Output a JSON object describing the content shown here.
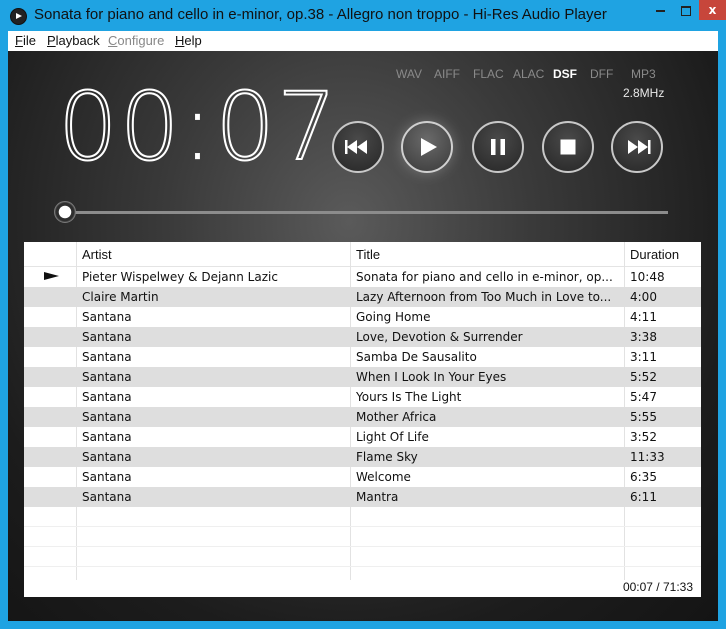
{
  "window": {
    "title": "Sonata for piano and cello in e-minor, op.38 - Allegro non troppo - Hi-Res Audio Player",
    "minimize": "minimize",
    "maximize": "maximize",
    "close": "x"
  },
  "menu": [
    {
      "label": "File",
      "underline": "F",
      "rest": "ile",
      "enabled": true
    },
    {
      "label": "Playback",
      "underline": "P",
      "rest": "layback",
      "enabled": true
    },
    {
      "label": "Configure",
      "underline": "C",
      "rest": "onfigure",
      "enabled": false
    },
    {
      "label": "Help",
      "underline": "H",
      "rest": "elp",
      "enabled": true
    }
  ],
  "formats": [
    "WAV",
    "AIFF",
    "FLAC",
    "ALAC",
    "DSF",
    "DFF",
    "MP3"
  ],
  "active_format": "DSF",
  "sample_rate": "2.8MHz",
  "time": {
    "minutes": "00",
    "seconds": "07"
  },
  "controls": [
    {
      "name": "previous-button",
      "icon": "skip-back-icon"
    },
    {
      "name": "play-button",
      "icon": "play-icon"
    },
    {
      "name": "pause-button",
      "icon": "pause-icon"
    },
    {
      "name": "stop-button",
      "icon": "stop-icon"
    },
    {
      "name": "next-button",
      "icon": "skip-forward-icon"
    }
  ],
  "seek": {
    "position_fraction": 0.0016
  },
  "playlist": {
    "columns": {
      "artist": "Artist",
      "title": "Title",
      "duration": "Duration"
    },
    "now_playing_index": 0,
    "tracks": [
      {
        "artist": "Pieter Wispelwey & Dejann Lazic",
        "title": "Sonata for piano and cello in e-minor, op...",
        "duration": "10:48"
      },
      {
        "artist": "Claire Martin",
        "title": "Lazy Afternoon from Too Much in Love to...",
        "duration": "4:00"
      },
      {
        "artist": "Santana",
        "title": "Going Home",
        "duration": "4:11"
      },
      {
        "artist": "Santana",
        "title": "Love, Devotion & Surrender",
        "duration": "3:38"
      },
      {
        "artist": "Santana",
        "title": "Samba De Sausalito",
        "duration": "3:11"
      },
      {
        "artist": "Santana",
        "title": "When I Look In Your Eyes",
        "duration": "5:52"
      },
      {
        "artist": "Santana",
        "title": "Yours Is The Light",
        "duration": "5:47"
      },
      {
        "artist": "Santana",
        "title": "Mother Africa",
        "duration": "5:55"
      },
      {
        "artist": "Santana",
        "title": "Light Of Life",
        "duration": "3:52"
      },
      {
        "artist": "Santana",
        "title": "Flame Sky",
        "duration": "11:33"
      },
      {
        "artist": "Santana",
        "title": "Welcome",
        "duration": "6:35"
      },
      {
        "artist": "Santana",
        "title": "Mantra",
        "duration": "6:11"
      }
    ],
    "total_time": "00:07 / 71:33"
  }
}
